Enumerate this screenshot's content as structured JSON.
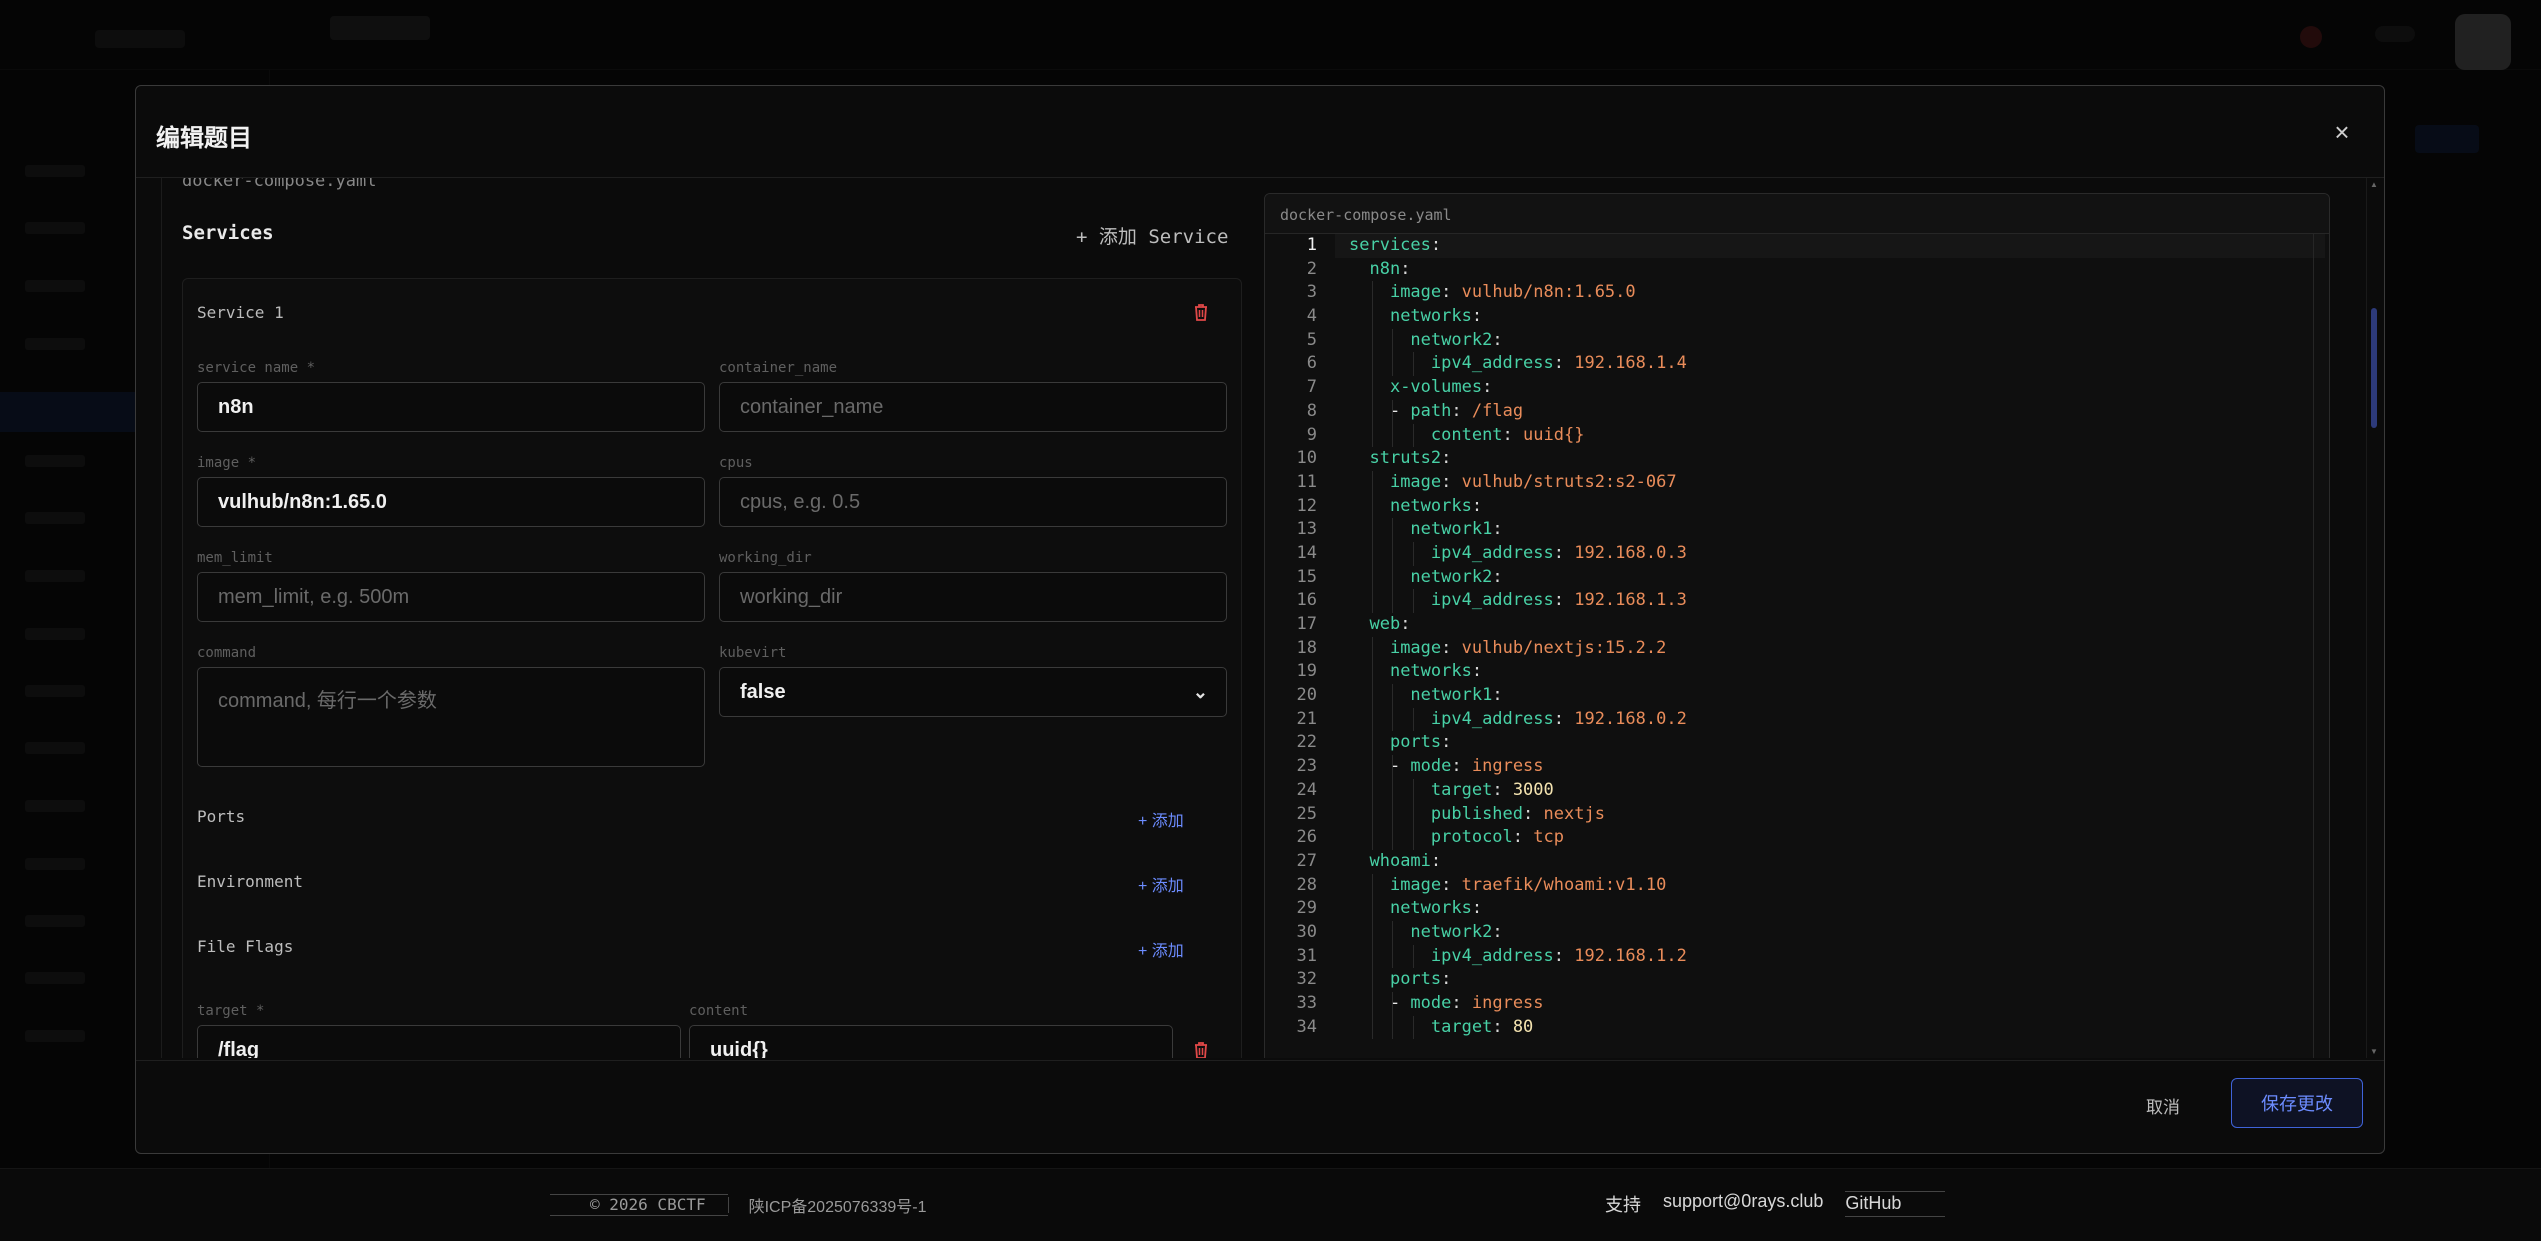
{
  "modal": {
    "title": "编辑题目",
    "file_label": "docker-compose.yaml",
    "services_heading": "Services",
    "add_service_label": "+ 添加 Service",
    "cancel_label": "取消",
    "save_label": "保存更改"
  },
  "service": {
    "title": "Service 1",
    "service_name": {
      "label": "service name *",
      "value": "n8n"
    },
    "container_name": {
      "label": "container_name",
      "placeholder": "container_name"
    },
    "image": {
      "label": "image *",
      "value": "vulhub/n8n:1.65.0"
    },
    "cpus": {
      "label": "cpus",
      "placeholder": "cpus, e.g. 0.5"
    },
    "mem_limit": {
      "label": "mem_limit",
      "placeholder": "mem_limit, e.g. 500m"
    },
    "working_dir": {
      "label": "working_dir",
      "placeholder": "working_dir"
    },
    "command": {
      "label": "command",
      "placeholder": "command, 每行一个参数"
    },
    "kubevirt": {
      "label": "kubevirt",
      "value": "false"
    },
    "sections": [
      {
        "label": "Ports",
        "add": "+ 添加"
      },
      {
        "label": "Environment",
        "add": "+ 添加"
      },
      {
        "label": "File Flags",
        "add": "+ 添加"
      }
    ],
    "file_flag": {
      "target_label": "target *",
      "target_value": "/flag",
      "content_label": "content",
      "content_value": "uuid{}"
    }
  },
  "editor": {
    "tab": "docker-compose.yaml",
    "active_line": 1,
    "lines": [
      {
        "indent": 0,
        "key": "services",
        "val": ""
      },
      {
        "indent": 1,
        "key": "n8n",
        "val": ""
      },
      {
        "indent": 2,
        "key": "image",
        "val": "vulhub/n8n:1.65.0"
      },
      {
        "indent": 2,
        "key": "networks",
        "val": ""
      },
      {
        "indent": 3,
        "key": "network2",
        "val": ""
      },
      {
        "indent": 4,
        "key": "ipv4_address",
        "val": "192.168.1.4"
      },
      {
        "indent": 2,
        "key": "x-volumes",
        "val": ""
      },
      {
        "indent": 3,
        "dash": true,
        "key": "path",
        "val": "/flag"
      },
      {
        "indent": 4,
        "key": "content",
        "val": "uuid{}"
      },
      {
        "indent": 1,
        "key": "struts2",
        "val": ""
      },
      {
        "indent": 2,
        "key": "image",
        "val": "vulhub/struts2:s2-067"
      },
      {
        "indent": 2,
        "key": "networks",
        "val": ""
      },
      {
        "indent": 3,
        "key": "network1",
        "val": ""
      },
      {
        "indent": 4,
        "key": "ipv4_address",
        "val": "192.168.0.3"
      },
      {
        "indent": 3,
        "key": "network2",
        "val": ""
      },
      {
        "indent": 4,
        "key": "ipv4_address",
        "val": "192.168.1.3"
      },
      {
        "indent": 1,
        "key": "web",
        "val": ""
      },
      {
        "indent": 2,
        "key": "image",
        "val": "vulhub/nextjs:15.2.2"
      },
      {
        "indent": 2,
        "key": "networks",
        "val": ""
      },
      {
        "indent": 3,
        "key": "network1",
        "val": ""
      },
      {
        "indent": 4,
        "key": "ipv4_address",
        "val": "192.168.0.2"
      },
      {
        "indent": 2,
        "key": "ports",
        "val": ""
      },
      {
        "indent": 3,
        "dash": true,
        "key": "mode",
        "val": "ingress"
      },
      {
        "indent": 4,
        "key": "target",
        "val": "3000",
        "num": true
      },
      {
        "indent": 4,
        "key": "published",
        "val": "nextjs"
      },
      {
        "indent": 4,
        "key": "protocol",
        "val": "tcp"
      },
      {
        "indent": 1,
        "key": "whoami",
        "val": ""
      },
      {
        "indent": 2,
        "key": "image",
        "val": "traefik/whoami:v1.10"
      },
      {
        "indent": 2,
        "key": "networks",
        "val": ""
      },
      {
        "indent": 3,
        "key": "network2",
        "val": ""
      },
      {
        "indent": 4,
        "key": "ipv4_address",
        "val": "192.168.1.2"
      },
      {
        "indent": 2,
        "key": "ports",
        "val": ""
      },
      {
        "indent": 3,
        "dash": true,
        "key": "mode",
        "val": "ingress"
      },
      {
        "indent": 4,
        "key": "target",
        "val": "80",
        "num": true
      }
    ]
  },
  "footer": {
    "copyright": "© 2026 CBCTF",
    "icp": "陕ICP备2025076339号-1",
    "support": "支持",
    "email": "support@0rays.club",
    "github": "GitHub"
  },
  "colors": {
    "accent": "#6c8cff",
    "danger": "#e04848",
    "yaml_key": "#48d1a6",
    "yaml_value": "#e98c5a"
  }
}
